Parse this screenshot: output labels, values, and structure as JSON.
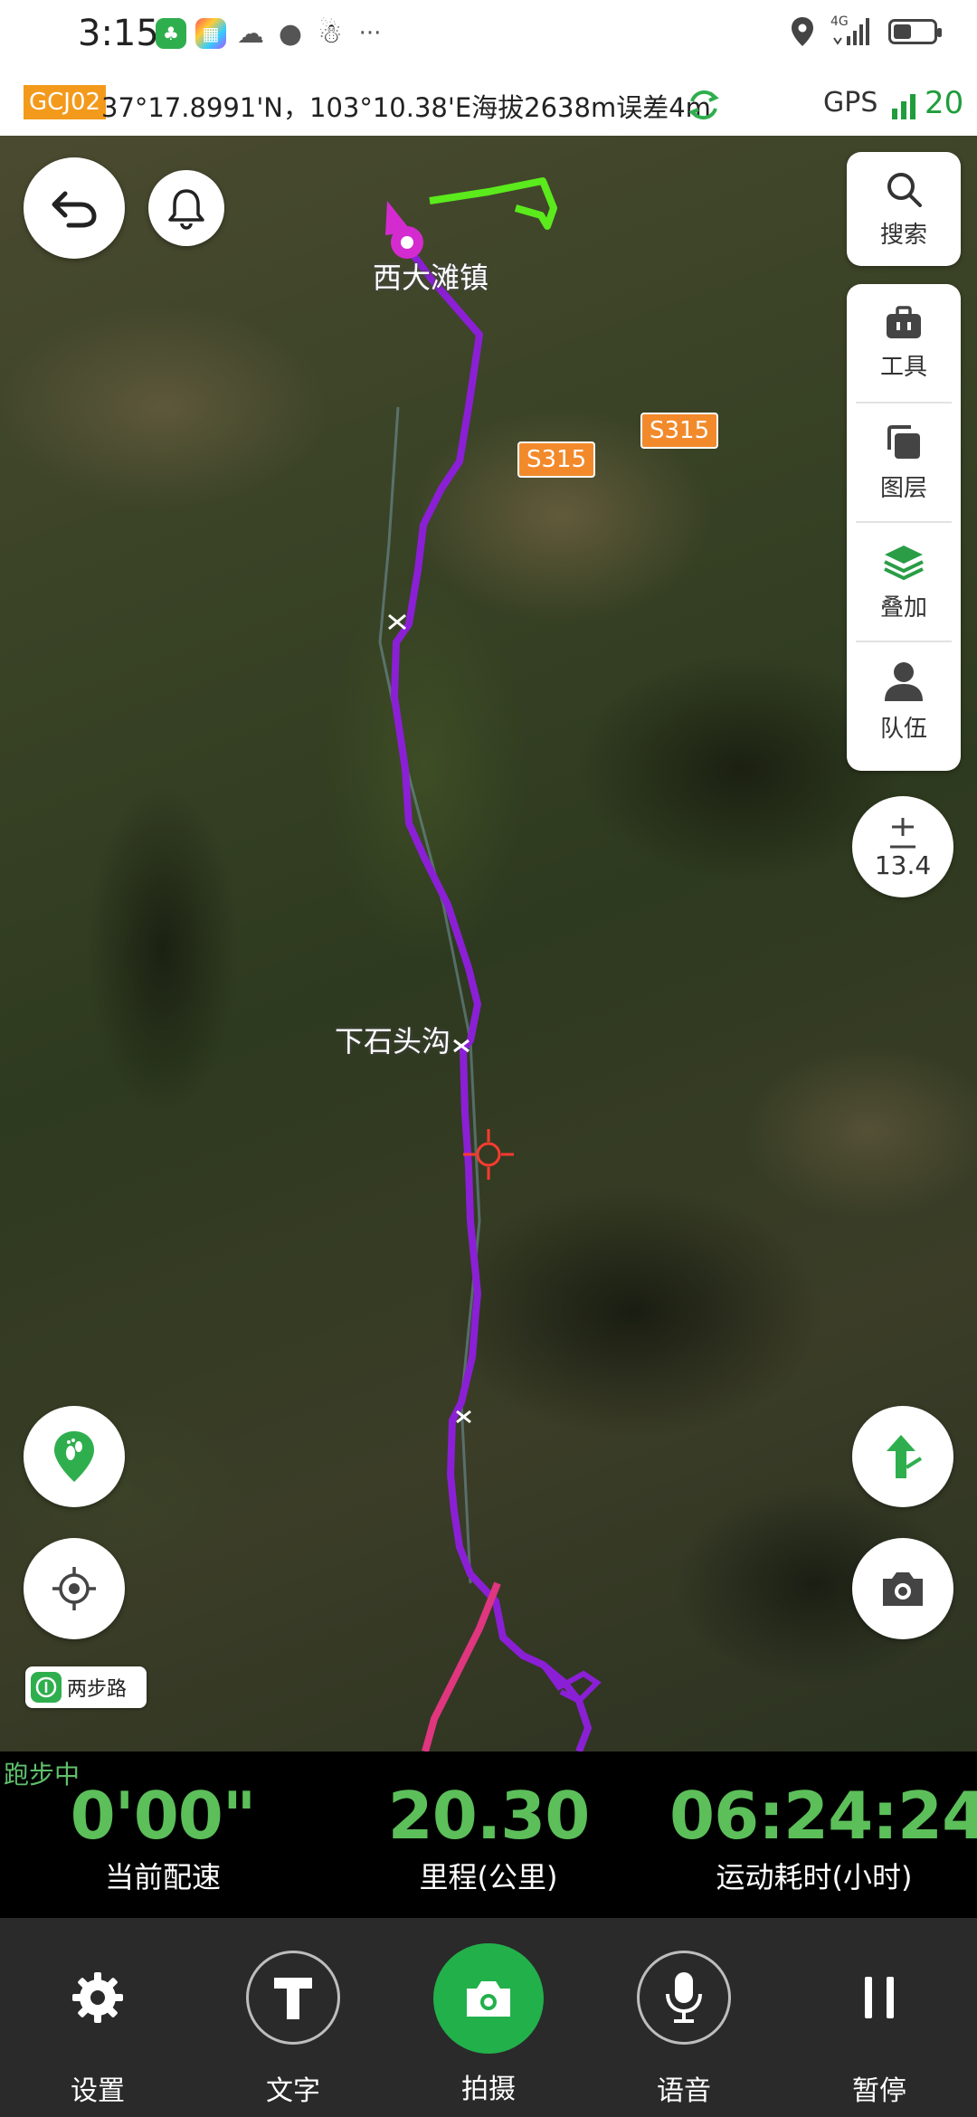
{
  "status_bar": {
    "time": "3:15",
    "network": "4G",
    "icons": [
      "app-leaf-icon",
      "app-colorful-icon",
      "wechat-icon",
      "message-icon",
      "qq-icon",
      "more-dots-icon",
      "location-icon",
      "signal-icon",
      "battery-icon"
    ]
  },
  "info_bar": {
    "crs": "GCJ02",
    "coords": "37°17.8991'N，103°10.38'E海拔2638m误差4m",
    "gps_label": "GPS",
    "gps_count": "20"
  },
  "map": {
    "town_label": "西大滩镇",
    "village_label": "下石头沟",
    "roads": [
      "S315",
      "S315"
    ],
    "zoom_level": "13.4",
    "search_label": "搜索",
    "tools": [
      {
        "label": "工具",
        "icon": "toolbox-icon"
      },
      {
        "label": "图层",
        "icon": "layers-copy-icon"
      },
      {
        "label": "叠加",
        "icon": "overlay-stack-icon"
      },
      {
        "label": "队伍",
        "icon": "team-person-icon"
      }
    ],
    "brand": "两步路",
    "route_color": "#8b1fd6",
    "accent": "#22b04b"
  },
  "stats": {
    "status": "跑步中",
    "pace": {
      "value": "0'00\"",
      "label": "当前配速"
    },
    "distance": {
      "value": "20.30",
      "label": "里程(公里)"
    },
    "duration": {
      "value": "06:24:24",
      "label": "运动耗时(小时)"
    }
  },
  "bottom_bar": {
    "items": [
      {
        "label": "设置",
        "icon": "gear-icon"
      },
      {
        "label": "文字",
        "icon": "text-t-icon"
      },
      {
        "label": "拍摄",
        "icon": "camera-icon"
      },
      {
        "label": "语音",
        "icon": "microphone-icon"
      },
      {
        "label": "暂停",
        "icon": "pause-icon"
      }
    ]
  }
}
